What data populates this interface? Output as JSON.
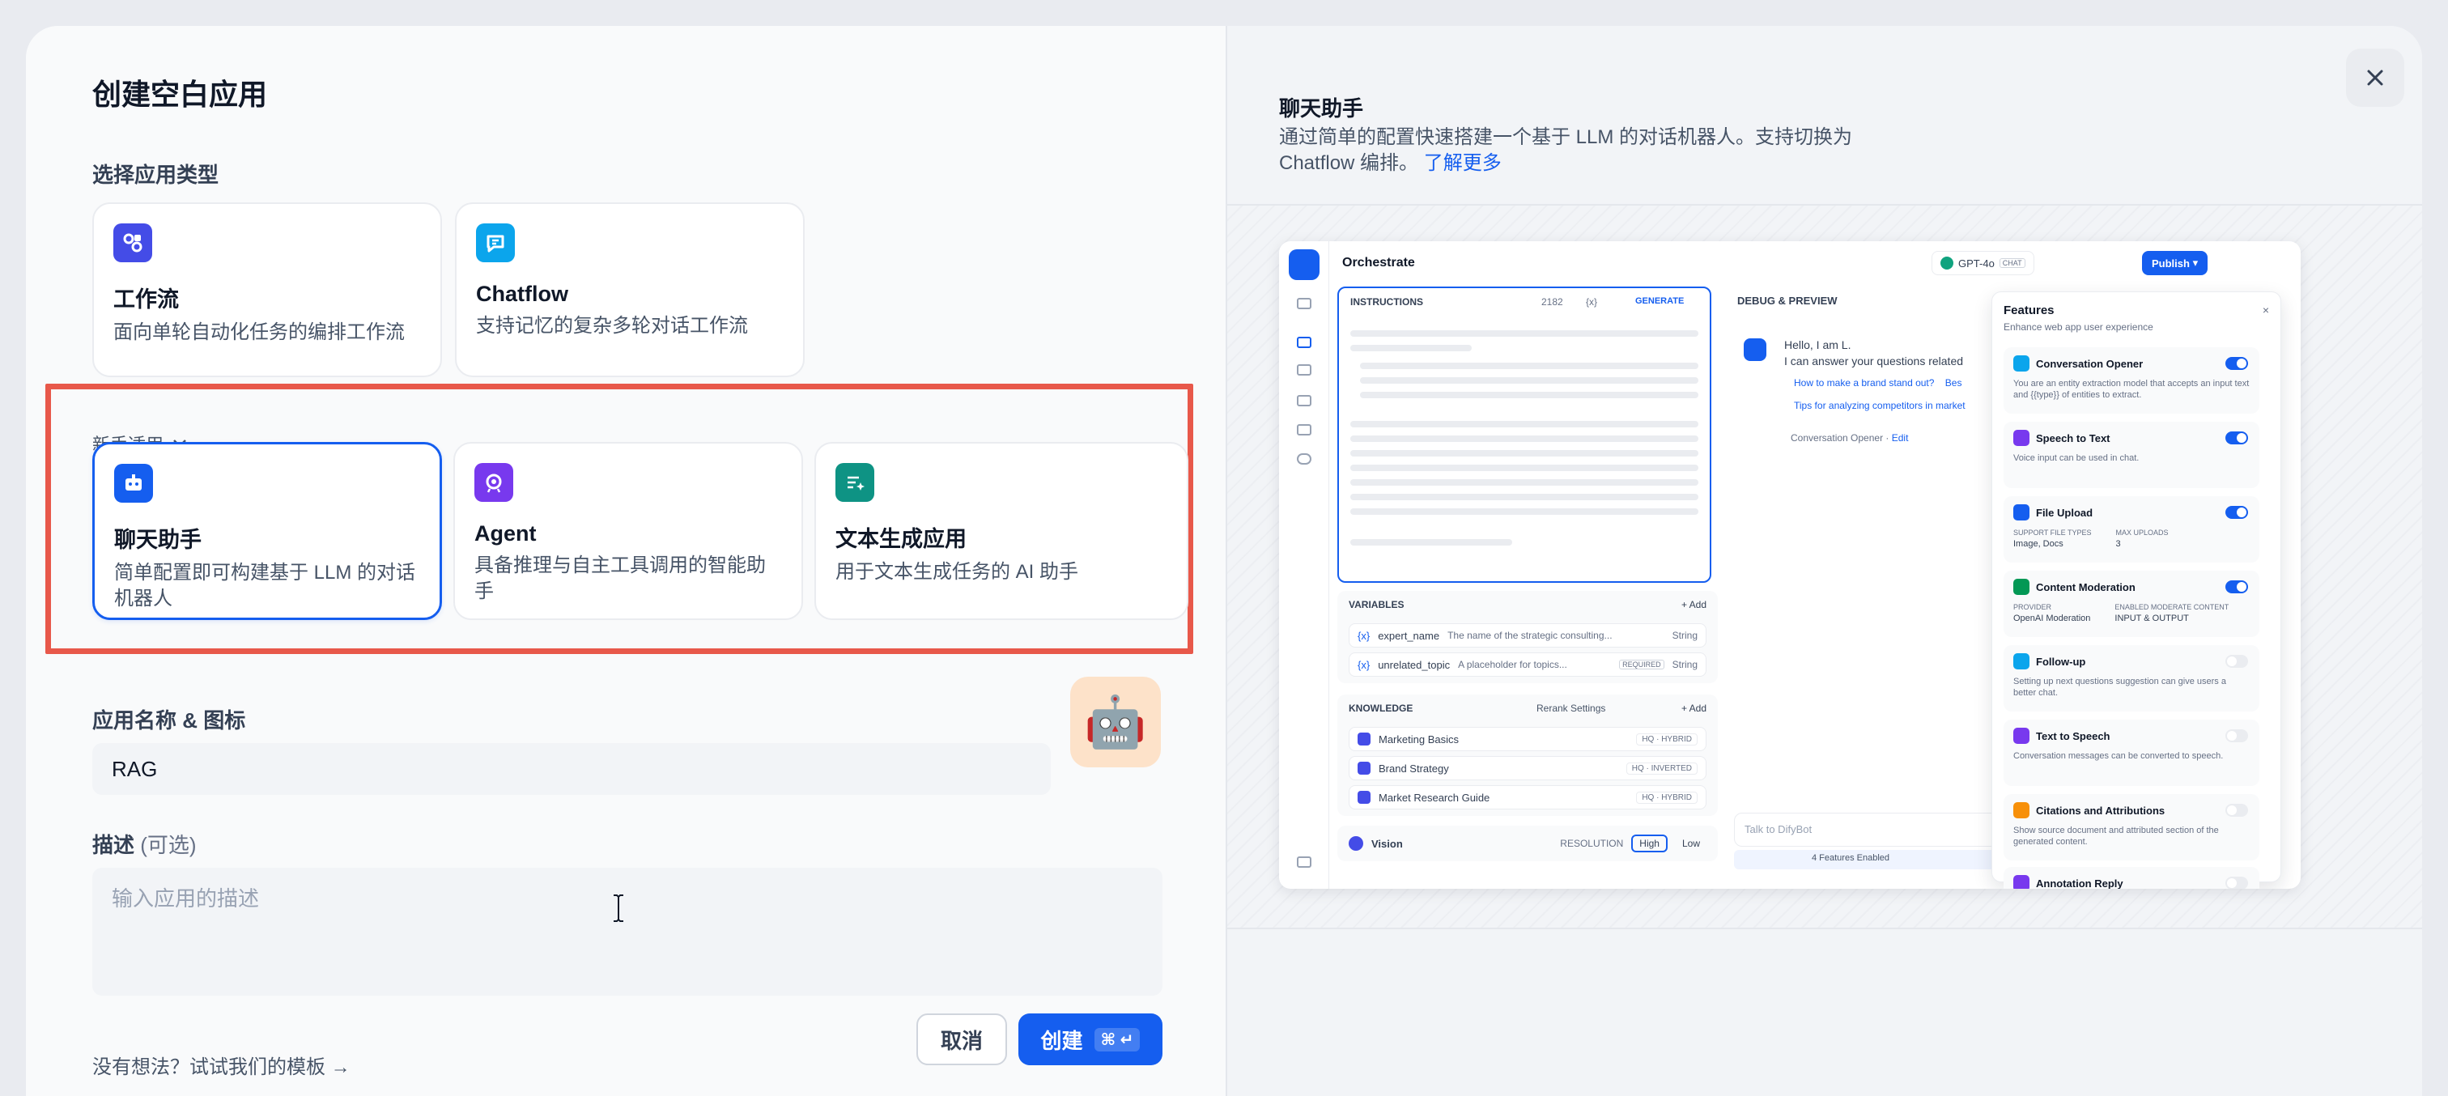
{
  "modal": {
    "title": "创建空白应用",
    "section_label": "选择应用类型",
    "app_types": [
      {
        "name": "工作流",
        "desc": "面向单轮自动化任务的编排工作流",
        "icon": "workflow-icon",
        "color": "#444ce7"
      },
      {
        "name": "Chatflow",
        "desc": "支持记忆的复杂多轮对话工作流",
        "icon": "chatflow-icon",
        "color": "#0ba5ec"
      }
    ],
    "beginner_label": "新手适用",
    "beginner_types": [
      {
        "name": "聊天助手",
        "desc": "简单配置即可构建基于 LLM 的对话机器人",
        "icon": "chatbot-icon",
        "color": "#155eef",
        "selected": true
      },
      {
        "name": "Agent",
        "desc": "具备推理与自主工具调用的智能助手",
        "icon": "agent-icon",
        "color": "#7839ee"
      },
      {
        "name": "文本生成应用",
        "desc": "用于文本生成任务的 AI 助手",
        "icon": "text-generator-icon",
        "color": "#0e9384"
      }
    ],
    "name_icon_label": "应用名称 & 图标",
    "app_name_value": "RAG",
    "app_icon_emoji": "🤖",
    "description_label": "描述",
    "description_optional": "(可选)",
    "description_placeholder": "输入应用的描述",
    "template_link": "没有想法？试试我们的模板 →",
    "cancel_label": "取消",
    "create_label": "创建",
    "create_shortcut": "⌘ ↵"
  },
  "preview": {
    "title": "聊天助手",
    "desc": "通过简单的配置快速搭建一个基于 LLM 的对话机器人。支持切换为 Chatflow 编排。",
    "learn_more": "了解更多",
    "mock": {
      "header_title": "Orchestrate",
      "model_name": "GPT-4o",
      "model_badge": "CHAT",
      "publish_label": "Publish",
      "instructions_label": "INSTRUCTIONS",
      "instructions_count": "2182",
      "var_button": "{x}",
      "generate_label": "GENERATE",
      "debug_label": "DEBUG & PREVIEW",
      "greeting_line1": "Hello, I am L.",
      "greeting_line2": "I can answer your questions related",
      "suggestion_1": "How to make a brand stand out?",
      "suggestion_1_cont": "Bes",
      "suggestion_2": "Tips for analyzing competitors in market",
      "opener_label": "Conversation Opener",
      "opener_edit": "Edit",
      "variables_label": "VARIABLES",
      "add_label": "Add",
      "variables": [
        {
          "name": "expert_name",
          "desc": "The name of the strategic consulting...",
          "type": "String",
          "required": ""
        },
        {
          "name": "unrelated_topic",
          "desc": "A placeholder for topics...",
          "type": "String",
          "required": "REQUIRED"
        }
      ],
      "knowledge_label": "KNOWLEDGE",
      "rerank_label": "Rerank Settings",
      "knowledge": [
        {
          "name": "Marketing Basics",
          "tag": "HQ · HYBRID"
        },
        {
          "name": "Brand Strategy",
          "tag": "HQ · INVERTED"
        },
        {
          "name": "Market Research Guide",
          "tag": "HQ · HYBRID"
        }
      ],
      "vision_label": "Vision",
      "resolution_label": "RESOLUTION",
      "res_high": "High",
      "res_low": "Low",
      "chat_placeholder": "Talk to DifyBot",
      "features_enabled": "4 Features Enabled",
      "features_title": "Features",
      "features_subtitle": "Enhance web app user experience",
      "features": [
        {
          "name": "Conversation Opener",
          "desc": "You are an entity extraction model that accepts an input text and {{type}} of entities to extract.",
          "on": true,
          "color": "#0ba5ec"
        },
        {
          "name": "Speech to Text",
          "desc": "Voice input can be used in chat.",
          "on": true,
          "color": "#7839ee"
        },
        {
          "name": "File Upload",
          "desc": "",
          "on": true,
          "color": "#155eef",
          "meta_1_label": "SUPPORT FILE TYPES",
          "meta_1_value": "Image, Docs",
          "meta_2_label": "MAX UPLOADS",
          "meta_2_value": "3"
        },
        {
          "name": "Content Moderation",
          "desc": "",
          "on": true,
          "color": "#039855",
          "meta_1_label": "PROVIDER",
          "meta_1_value": "OpenAI Moderation",
          "meta_2_label": "ENABLED MODERATE CONTENT",
          "meta_2_value": "INPUT & OUTPUT"
        },
        {
          "name": "Follow-up",
          "desc": "Setting up next questions suggestion can give users a better chat.",
          "on": false,
          "color": "#0ba5ec"
        },
        {
          "name": "Text to Speech",
          "desc": "Conversation messages can be converted to speech.",
          "on": false,
          "color": "#7839ee"
        },
        {
          "name": "Citations and Attributions",
          "desc": "Show source document and attributed section of the generated content.",
          "on": false,
          "color": "#f79009"
        },
        {
          "name": "Annotation Reply",
          "desc": "",
          "on": false,
          "color": "#7839ee"
        }
      ]
    }
  }
}
